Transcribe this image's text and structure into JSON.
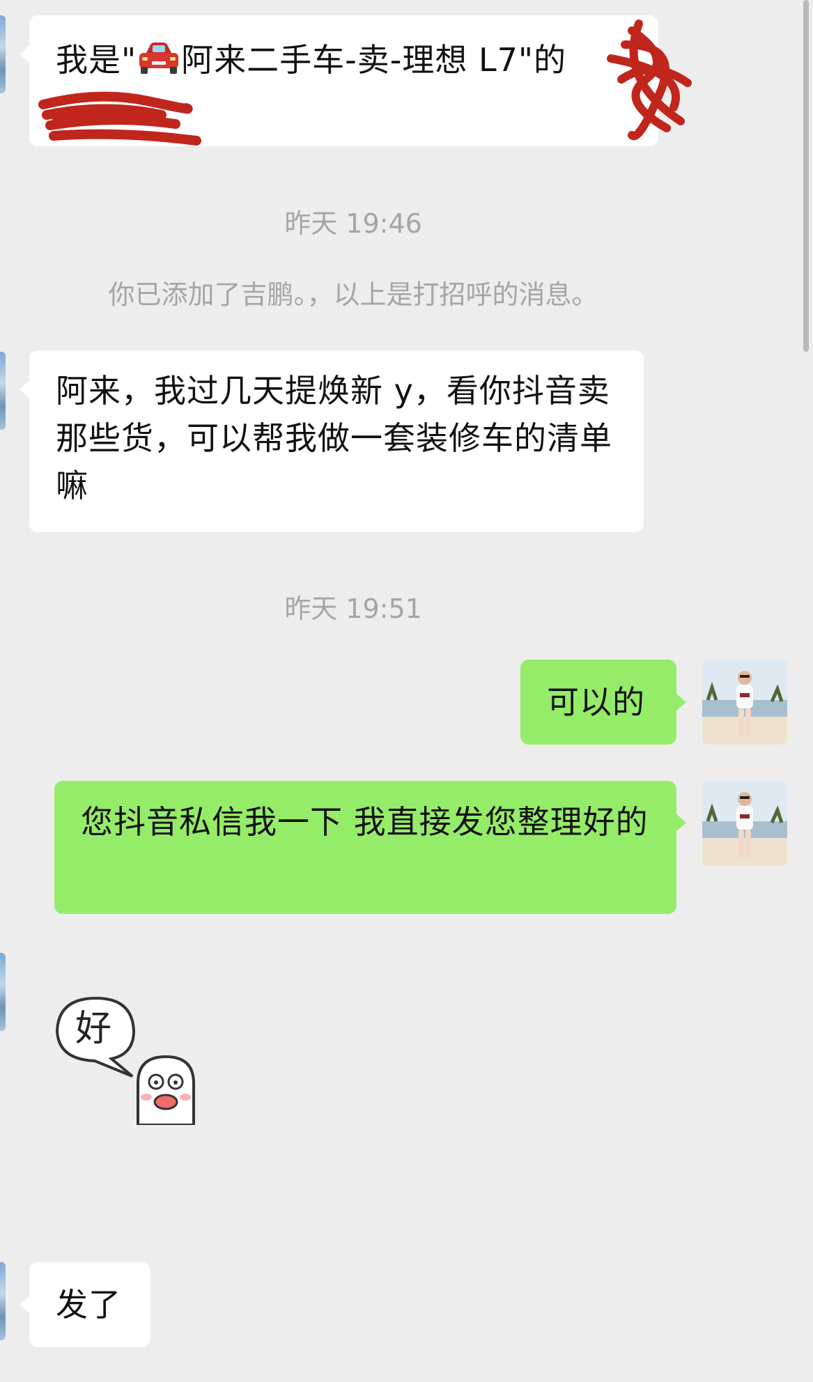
{
  "messages": {
    "greeting_prefix": "我是\"",
    "greeting_suffix": "阿来二手车-卖-理想 L7\"的",
    "time_1": "昨天 19:46",
    "system_notice": "你已添加了吉鹏。，以上是打招呼的消息。",
    "incoming_2": "阿来，我过几天提焕新 y，看你抖音卖那些货，可以帮我做一套装修车的清单嘛",
    "time_2": "昨天 19:51",
    "outgoing_1": "可以的",
    "outgoing_2": "您抖音私信我一下 我直接发您整理好的",
    "sticker_text": "好",
    "incoming_3": "发了"
  },
  "icons": {
    "car": "red-car-emoji",
    "sticker": "ghost-sticker",
    "avatar": "user-avatar"
  },
  "colors": {
    "background": "#ededed",
    "incoming_bubble": "#ffffff",
    "outgoing_bubble": "#95ec69",
    "timestamp_text": "#a5a5a5",
    "redaction": "#c0261c"
  }
}
